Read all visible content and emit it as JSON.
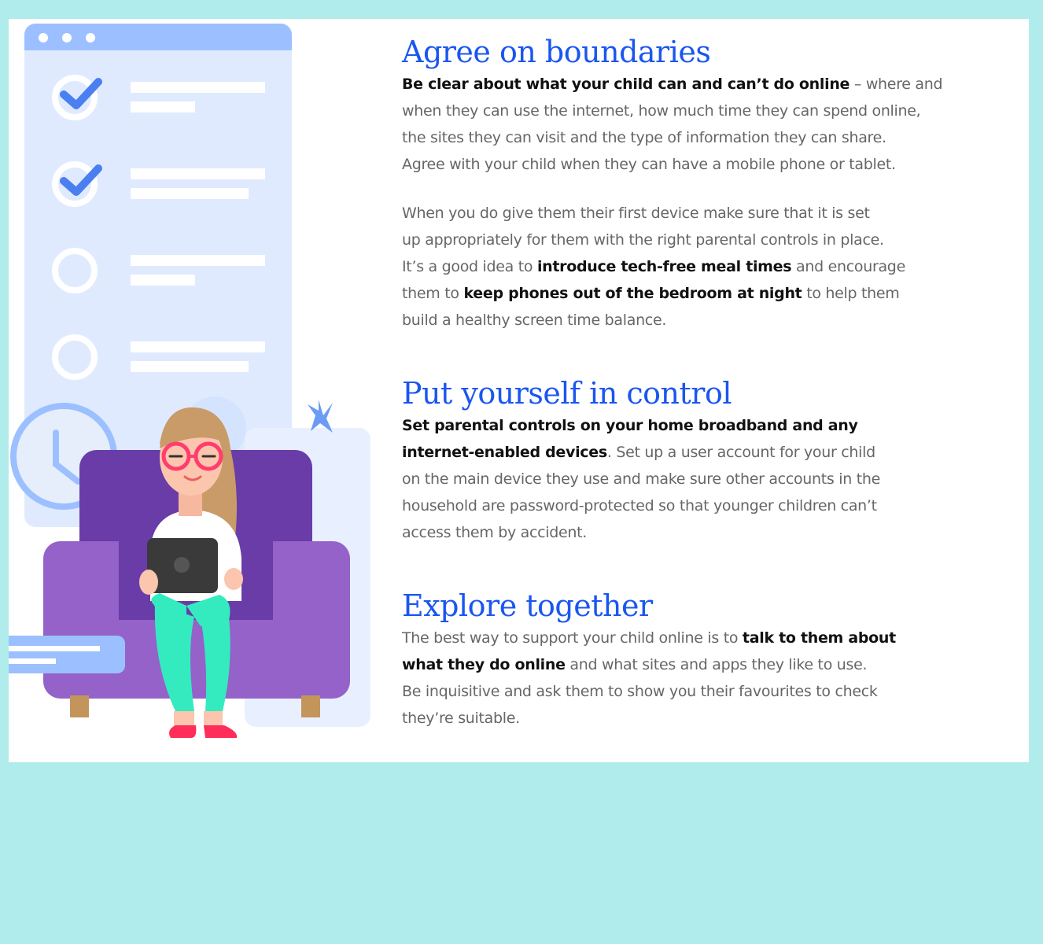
{
  "colors": {
    "background": "#b0ecec",
    "heading": "#1a56f0",
    "body_text": "#666666",
    "bold_text": "#111111",
    "armchair": "#9462c8",
    "armchair_back": "#6a3ca8",
    "checklist": "#e0eaff"
  },
  "illustration": {
    "icons": [
      "browser-window-icon",
      "checkmark-icon",
      "clock-icon",
      "star-icon",
      "tablet-icon",
      "armchair-icon",
      "child-figure"
    ]
  },
  "sections": [
    {
      "heading": "Agree on boundaries",
      "paragraphs": [
        {
          "b1": "Be clear about what your child can and can’t do online",
          "t1": " – where and\nwhen they can use the internet, how much time they can spend online,\nthe sites they can visit and the type of information they can share.\nAgree with your child when they can have a mobile phone or tablet."
        },
        {
          "t1": "When you do give them their first device make sure that it is set\nup appropriately for them with the right parental controls in place.\nIt’s a good idea to ",
          "b1": "introduce tech-free meal times",
          "t2": " and encourage\nthem to ",
          "b2": "keep phones out of the bedroom at night",
          "t3": " to help them\nbuild a healthy screen time balance."
        }
      ]
    },
    {
      "heading": "Put yourself in control",
      "paragraphs": [
        {
          "b1": "Set parental controls on your home broadband and any\ninternet-enabled devices",
          "t1": ". Set up a user account for your child\non the main device they use and make sure other accounts in the\nhousehold are password-protected so that younger children can’t\naccess them by accident."
        }
      ]
    },
    {
      "heading": "Explore together",
      "paragraphs": [
        {
          "t1": "The best way to support your child online is to ",
          "b1": "talk to them about\nwhat they do online",
          "t2": " and what sites and apps they like to use.\nBe inquisitive and ask them to show you their favourites to check\nthey’re suitable."
        }
      ]
    }
  ]
}
